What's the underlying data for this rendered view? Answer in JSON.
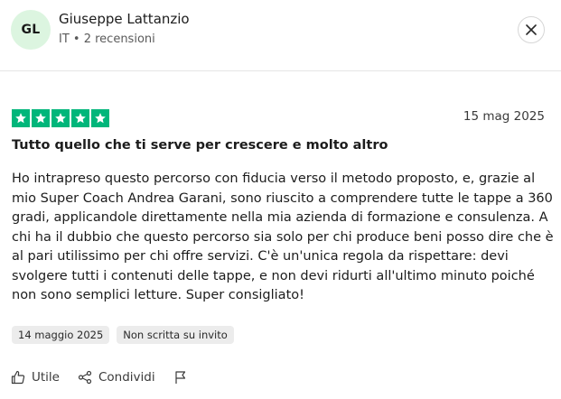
{
  "reviewer": {
    "initials": "GL",
    "name": "Giuseppe Lattanzio",
    "meta": "IT • 2 recensioni"
  },
  "review": {
    "rating": 5,
    "date": "15 mag 2025",
    "title": "Tutto quello che ti serve per crescere e molto altro",
    "body": "Ho intrapreso questo percorso con fiducia verso il metodo proposto, e, grazie al mio Super Coach Andrea Garani, sono riuscito a comprendere tutte le tappe a 360 gradi, applicandole direttamente nella mia azienda di formazione e consulenza. A chi ha il dubbio che questo percorso sia solo per chi produce beni posso dire che è al pari utilissimo per chi offre servizi. C'è un'unica regola da rispettare: devi svolgere tutti i contenuti delle tappe, e non devi ridurti all'ultimo minuto poiché non sono semplici letture. Super consigliato!",
    "experience_date": "14 maggio 2025",
    "invite_status": "Non scritta su invito"
  },
  "actions": {
    "useful_label": "Utile",
    "share_label": "Condividi"
  },
  "colors": {
    "star_green": "#00b67a",
    "avatar_bg": "#dcf5e0"
  },
  "icons": {
    "close": "close-icon",
    "star": "star-icon",
    "thumbs_up": "thumbs-up-icon",
    "share": "share-icon",
    "flag": "flag-icon"
  }
}
